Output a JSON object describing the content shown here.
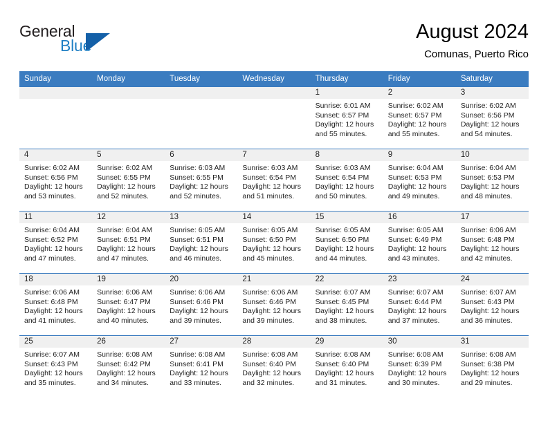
{
  "brand": {
    "name_part1": "General",
    "name_part2": "Blue",
    "mark": "blue-triangle-logo"
  },
  "header": {
    "title": "August 2024",
    "subtitle": "Comunas, Puerto Rico"
  },
  "colors": {
    "header_blue": "#3b7cc0",
    "brand_blue": "#1f7fc4",
    "daynum_strip": "#f0f0f0",
    "text": "#222222"
  },
  "weekday_headers": [
    "Sunday",
    "Monday",
    "Tuesday",
    "Wednesday",
    "Thursday",
    "Friday",
    "Saturday"
  ],
  "weeks": [
    [
      {
        "day": "",
        "empty": true
      },
      {
        "day": "",
        "empty": true
      },
      {
        "day": "",
        "empty": true
      },
      {
        "day": "",
        "empty": true
      },
      {
        "day": "1",
        "sunrise": "Sunrise: 6:01 AM",
        "sunset": "Sunset: 6:57 PM",
        "daylight1": "Daylight: 12 hours",
        "daylight2": "and 55 minutes."
      },
      {
        "day": "2",
        "sunrise": "Sunrise: 6:02 AM",
        "sunset": "Sunset: 6:57 PM",
        "daylight1": "Daylight: 12 hours",
        "daylight2": "and 55 minutes."
      },
      {
        "day": "3",
        "sunrise": "Sunrise: 6:02 AM",
        "sunset": "Sunset: 6:56 PM",
        "daylight1": "Daylight: 12 hours",
        "daylight2": "and 54 minutes."
      }
    ],
    [
      {
        "day": "4",
        "sunrise": "Sunrise: 6:02 AM",
        "sunset": "Sunset: 6:56 PM",
        "daylight1": "Daylight: 12 hours",
        "daylight2": "and 53 minutes."
      },
      {
        "day": "5",
        "sunrise": "Sunrise: 6:02 AM",
        "sunset": "Sunset: 6:55 PM",
        "daylight1": "Daylight: 12 hours",
        "daylight2": "and 52 minutes."
      },
      {
        "day": "6",
        "sunrise": "Sunrise: 6:03 AM",
        "sunset": "Sunset: 6:55 PM",
        "daylight1": "Daylight: 12 hours",
        "daylight2": "and 52 minutes."
      },
      {
        "day": "7",
        "sunrise": "Sunrise: 6:03 AM",
        "sunset": "Sunset: 6:54 PM",
        "daylight1": "Daylight: 12 hours",
        "daylight2": "and 51 minutes."
      },
      {
        "day": "8",
        "sunrise": "Sunrise: 6:03 AM",
        "sunset": "Sunset: 6:54 PM",
        "daylight1": "Daylight: 12 hours",
        "daylight2": "and 50 minutes."
      },
      {
        "day": "9",
        "sunrise": "Sunrise: 6:04 AM",
        "sunset": "Sunset: 6:53 PM",
        "daylight1": "Daylight: 12 hours",
        "daylight2": "and 49 minutes."
      },
      {
        "day": "10",
        "sunrise": "Sunrise: 6:04 AM",
        "sunset": "Sunset: 6:53 PM",
        "daylight1": "Daylight: 12 hours",
        "daylight2": "and 48 minutes."
      }
    ],
    [
      {
        "day": "11",
        "sunrise": "Sunrise: 6:04 AM",
        "sunset": "Sunset: 6:52 PM",
        "daylight1": "Daylight: 12 hours",
        "daylight2": "and 47 minutes."
      },
      {
        "day": "12",
        "sunrise": "Sunrise: 6:04 AM",
        "sunset": "Sunset: 6:51 PM",
        "daylight1": "Daylight: 12 hours",
        "daylight2": "and 47 minutes."
      },
      {
        "day": "13",
        "sunrise": "Sunrise: 6:05 AM",
        "sunset": "Sunset: 6:51 PM",
        "daylight1": "Daylight: 12 hours",
        "daylight2": "and 46 minutes."
      },
      {
        "day": "14",
        "sunrise": "Sunrise: 6:05 AM",
        "sunset": "Sunset: 6:50 PM",
        "daylight1": "Daylight: 12 hours",
        "daylight2": "and 45 minutes."
      },
      {
        "day": "15",
        "sunrise": "Sunrise: 6:05 AM",
        "sunset": "Sunset: 6:50 PM",
        "daylight1": "Daylight: 12 hours",
        "daylight2": "and 44 minutes."
      },
      {
        "day": "16",
        "sunrise": "Sunrise: 6:05 AM",
        "sunset": "Sunset: 6:49 PM",
        "daylight1": "Daylight: 12 hours",
        "daylight2": "and 43 minutes."
      },
      {
        "day": "17",
        "sunrise": "Sunrise: 6:06 AM",
        "sunset": "Sunset: 6:48 PM",
        "daylight1": "Daylight: 12 hours",
        "daylight2": "and 42 minutes."
      }
    ],
    [
      {
        "day": "18",
        "sunrise": "Sunrise: 6:06 AM",
        "sunset": "Sunset: 6:48 PM",
        "daylight1": "Daylight: 12 hours",
        "daylight2": "and 41 minutes."
      },
      {
        "day": "19",
        "sunrise": "Sunrise: 6:06 AM",
        "sunset": "Sunset: 6:47 PM",
        "daylight1": "Daylight: 12 hours",
        "daylight2": "and 40 minutes."
      },
      {
        "day": "20",
        "sunrise": "Sunrise: 6:06 AM",
        "sunset": "Sunset: 6:46 PM",
        "daylight1": "Daylight: 12 hours",
        "daylight2": "and 39 minutes."
      },
      {
        "day": "21",
        "sunrise": "Sunrise: 6:06 AM",
        "sunset": "Sunset: 6:46 PM",
        "daylight1": "Daylight: 12 hours",
        "daylight2": "and 39 minutes."
      },
      {
        "day": "22",
        "sunrise": "Sunrise: 6:07 AM",
        "sunset": "Sunset: 6:45 PM",
        "daylight1": "Daylight: 12 hours",
        "daylight2": "and 38 minutes."
      },
      {
        "day": "23",
        "sunrise": "Sunrise: 6:07 AM",
        "sunset": "Sunset: 6:44 PM",
        "daylight1": "Daylight: 12 hours",
        "daylight2": "and 37 minutes."
      },
      {
        "day": "24",
        "sunrise": "Sunrise: 6:07 AM",
        "sunset": "Sunset: 6:43 PM",
        "daylight1": "Daylight: 12 hours",
        "daylight2": "and 36 minutes."
      }
    ],
    [
      {
        "day": "25",
        "sunrise": "Sunrise: 6:07 AM",
        "sunset": "Sunset: 6:43 PM",
        "daylight1": "Daylight: 12 hours",
        "daylight2": "and 35 minutes."
      },
      {
        "day": "26",
        "sunrise": "Sunrise: 6:08 AM",
        "sunset": "Sunset: 6:42 PM",
        "daylight1": "Daylight: 12 hours",
        "daylight2": "and 34 minutes."
      },
      {
        "day": "27",
        "sunrise": "Sunrise: 6:08 AM",
        "sunset": "Sunset: 6:41 PM",
        "daylight1": "Daylight: 12 hours",
        "daylight2": "and 33 minutes."
      },
      {
        "day": "28",
        "sunrise": "Sunrise: 6:08 AM",
        "sunset": "Sunset: 6:40 PM",
        "daylight1": "Daylight: 12 hours",
        "daylight2": "and 32 minutes."
      },
      {
        "day": "29",
        "sunrise": "Sunrise: 6:08 AM",
        "sunset": "Sunset: 6:40 PM",
        "daylight1": "Daylight: 12 hours",
        "daylight2": "and 31 minutes."
      },
      {
        "day": "30",
        "sunrise": "Sunrise: 6:08 AM",
        "sunset": "Sunset: 6:39 PM",
        "daylight1": "Daylight: 12 hours",
        "daylight2": "and 30 minutes."
      },
      {
        "day": "31",
        "sunrise": "Sunrise: 6:08 AM",
        "sunset": "Sunset: 6:38 PM",
        "daylight1": "Daylight: 12 hours",
        "daylight2": "and 29 minutes."
      }
    ]
  ]
}
